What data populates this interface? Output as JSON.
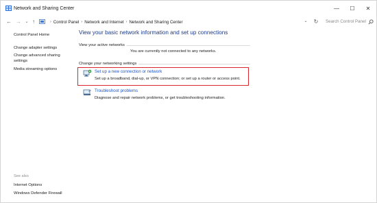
{
  "window": {
    "title": "Network and Sharing Center",
    "minimize": "—",
    "maximize": "☐",
    "close": "✕"
  },
  "nav": {
    "back": "←",
    "forward": "→",
    "recent": "⌄",
    "up": "↑",
    "breadcrumbs": [
      "Control Panel",
      "Network and Internet",
      "Network and Sharing Center"
    ],
    "separator": "›",
    "dropdown": "⌄",
    "refresh": "↻",
    "search_placeholder": "Search Control Panel"
  },
  "sidebar": {
    "items": [
      {
        "label": "Control Panel Home"
      },
      {
        "label": "Change adapter settings"
      },
      {
        "label": "Change advanced sharing"
      },
      {
        "label": "settings"
      },
      {
        "label": "Media streaming options"
      }
    ],
    "see_also": "See also",
    "see_also_items": [
      {
        "label": "Internet Options"
      },
      {
        "label": "Windows Defender Firewall"
      }
    ]
  },
  "main": {
    "title": "View your basic network information and set up connections",
    "active_networks_label": "View your active networks",
    "active_networks_status": "You are currently not connected to any networks.",
    "change_settings_label": "Change your networking settings",
    "tasks": [
      {
        "link": "Set up a new connection or network",
        "desc": "Set up a broadband, dial-up, or VPN connection; or set up a router or access point."
      },
      {
        "link": "Troubleshoot problems",
        "desc": "Diagnose and repair network problems, or get troubleshooting information."
      }
    ]
  },
  "colors": {
    "link": "#1c56c9",
    "title": "#1b3a8a",
    "highlight": "#d9262c"
  }
}
